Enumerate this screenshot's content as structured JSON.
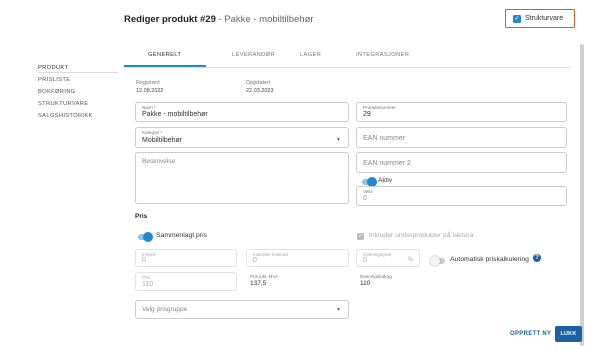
{
  "header": {
    "title_prefix": "Rediger produkt #29",
    "title_sep": " - ",
    "title_name": "Pakke - mobiltilbehør",
    "struktur_label": "Strukturvare"
  },
  "sidebar": {
    "items": [
      {
        "label": "PRODUKT"
      },
      {
        "label": "PRISLISTE"
      },
      {
        "label": "BOKFØRING"
      },
      {
        "label": "STRUKTURVARE"
      },
      {
        "label": "SALGSHISTORIKK"
      }
    ]
  },
  "tabs": [
    {
      "label": "GENERELT"
    },
    {
      "label": "LEVERANDØR"
    },
    {
      "label": "LAGER"
    },
    {
      "label": "INTEGRASJONER"
    }
  ],
  "meta": {
    "registrert_label": "Registrert",
    "registrert_value": "12.08.2022",
    "oppdatert_label": "Oppdatert",
    "oppdatert_value": "22.03.2023"
  },
  "form": {
    "navn_label": "Navn *",
    "navn_value": "Pakke - mobiltilbehør",
    "produktnummer_label": "Produktnummer",
    "produktnummer_value": "29",
    "kategori_label": "Kategori *",
    "kategori_value": "Mobiltilbehør",
    "ean_placeholder": "EAN nummer",
    "beskrivelse_placeholder": "Beskrivelse",
    "ean2_placeholder": "EAN nummer 2",
    "aktiv_label": "Aktiv",
    "vekt_label": "Vekt",
    "vekt_value": "0"
  },
  "pris": {
    "section_title": "Pris",
    "sammenlagt_label": "Sammenlagt pris",
    "inkluder_label": "Inkluder underprodukter på faktura",
    "innpris_label": "Innpris",
    "innpris_value": "0",
    "indirekte_label": "Indirekte kostnad",
    "indirekte_value": "0",
    "dekning_label": "Dekningsgrad",
    "dekning_value": "0",
    "dekning_suffix": "%",
    "auto_label": "Automatisk priskalkulering",
    "help_icon_glyph": "?",
    "pris_label": "Pris",
    "pris_value": "110",
    "pris_inkl_label": "Pris inkl. MVA",
    "pris_inkl_value": "137,5",
    "dekningsbidrag_label": "Dekningsbidrag",
    "dekningsbidrag_value": "110",
    "prisgruppe_placeholder": "Velg prisgruppe"
  },
  "footer": {
    "opprett_label": "OPPRETT NY",
    "lukk_label": "LUKK"
  },
  "colors": {
    "accent": "#1f8ad1",
    "primary_button": "#1f5fa5",
    "highlight_border": "#e4582d"
  }
}
